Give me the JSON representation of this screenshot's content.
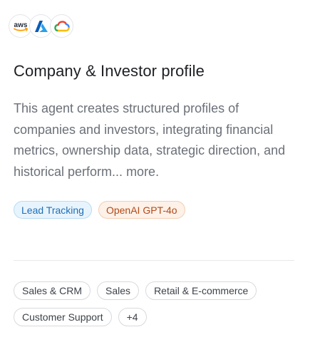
{
  "providers": [
    {
      "name": "aws-icon",
      "label": "aws"
    },
    {
      "name": "azure-icon"
    },
    {
      "name": "google-cloud-icon"
    }
  ],
  "title": "Company & Investor profile",
  "description": "This agent creates structured profiles of companies and investors, integrating financial metrics, ownership data, strategic direction, and historical perform...",
  "more_label": "more.",
  "badges": {
    "lead_tracking": "Lead Tracking",
    "model": "OpenAI GPT-4o"
  },
  "colors": {
    "aws_orange": "#ff9900",
    "azure_blue": "#0a6ed1",
    "gcp_red": "#ea4335",
    "gcp_yellow": "#fbbc05",
    "gcp_green": "#34a853",
    "gcp_blue": "#4285f4"
  },
  "tags": [
    "Sales & CRM",
    "Sales",
    "Retail & E-commerce",
    "Customer Support",
    "+4"
  ]
}
